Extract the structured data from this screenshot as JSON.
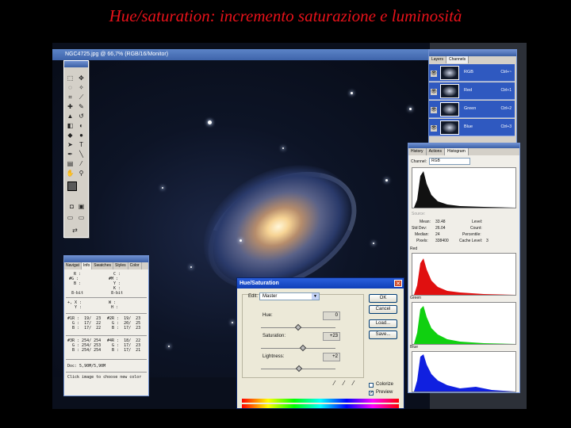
{
  "slide": {
    "title": "Hue/saturation: incremento saturazione e luminosità"
  },
  "image_window": {
    "title": "NGC4725.jpg @ 66,7% (RGB/16/Monitor)"
  },
  "channels_panel": {
    "tabs": [
      "Layers",
      "Channels"
    ],
    "active_tab": "Channels",
    "rows": [
      {
        "name": "RGB",
        "shortcut": "Ctrl+~"
      },
      {
        "name": "Red",
        "shortcut": "Ctrl+1"
      },
      {
        "name": "Green",
        "shortcut": "Ctrl+2"
      },
      {
        "name": "Blue",
        "shortcut": "Ctrl+3"
      }
    ]
  },
  "histogram_panel": {
    "tabs": [
      "History",
      "Actions",
      "Histogram"
    ],
    "active_tab": "Histogram",
    "channel_label": "Channel:",
    "channel_value": "RGB",
    "source_label": "Source:",
    "stats": {
      "mean_label": "Mean:",
      "mean": "33.48",
      "stddev_label": "Std Dev:",
      "stddev": "26.04",
      "median_label": "Median:",
      "median": "24",
      "pixels_label": "Pixels:",
      "pixels": "338400",
      "level_label": "Level:",
      "count_label": "Count:",
      "percentile_label": "Percentile:",
      "cache_label": "Cache Level:",
      "cache": "3"
    },
    "channel_labels": [
      "Red",
      "Green",
      "Blue"
    ],
    "colors": {
      "rgb": "#111111",
      "red": "#e01010",
      "green": "#10d010",
      "blue": "#1020e0"
    }
  },
  "info_panel": {
    "tabs": [
      "Navigat",
      "Info",
      "Swatches",
      "Styles",
      "Color"
    ],
    "active_tab": "Info",
    "block1_left": "  R :\n#G :\n  B :\n\n 8-bit",
    "block1_right": "  C :\n#M :\n  Y :\n  K :\n 8-bit",
    "block2_left": "+, X :\n   Y :",
    "block2_right": "W :\n H :",
    "block3_left": "#1R :  19/  23\n  G :  17/  22\n  B :  17/  22",
    "block3_right": "#2R :  19/  23\n  G :  20/  25\n  B :  17/  23",
    "block4_left": "#3R : 254/ 254\n  G : 254/ 253\n  B : 254/ 254",
    "block4_right": "#4R :  18/  22\n  G :  17/  23\n  B :  17/  21",
    "doc": "Doc: 5,90M/5,90M",
    "hint": "Click image to choose new color"
  },
  "hue_sat_dialog": {
    "title": "Hue/Saturation",
    "edit_label": "Edit:",
    "edit_value": "Master",
    "hue_label": "Hue:",
    "hue_value": "0",
    "hue_fraction": 0.5,
    "saturation_label": "Saturation:",
    "saturation_value": "+23",
    "saturation_fraction": 0.56,
    "lightness_label": "Lightness:",
    "lightness_value": "+2",
    "lightness_fraction": 0.51,
    "ok_label": "OK",
    "cancel_label": "Cancel",
    "load_label": "Load...",
    "save_label": "Save...",
    "colorize_label": "Colorize",
    "preview_label": "Preview",
    "preview_checked": true
  }
}
